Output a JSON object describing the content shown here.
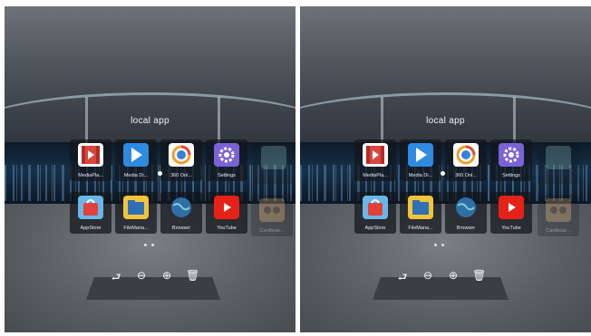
{
  "panel": {
    "title": "local app"
  },
  "apps": [
    {
      "label": "MediaPla...",
      "icon": "media-player-icon",
      "color": "#d9473f"
    },
    {
      "label": "Media Di...",
      "icon": "media-di-icon",
      "color": "#2e8be0"
    },
    {
      "label": "360 Onl...",
      "icon": "360-online-icon",
      "color": "#ffffff"
    },
    {
      "label": "Settings",
      "icon": "settings-icon",
      "color": "#7a63d6"
    },
    {
      "label": "",
      "icon": "faded-app-icon",
      "color": "#7ea1a0"
    },
    {
      "label": "AppStore",
      "icon": "app-store-icon",
      "color": "#e2403a"
    },
    {
      "label": "FileMana...",
      "icon": "file-manager-icon",
      "color": "#f3c43a"
    },
    {
      "label": "Browser",
      "icon": "browser-icon",
      "color": "#2f6fa7"
    },
    {
      "label": "YouTube",
      "icon": "youtube-icon",
      "color": "#e62117"
    },
    {
      "label": "Cardboar...",
      "icon": "cardboard-icon",
      "color": "#c79a5e"
    }
  ],
  "toolbar": {
    "back": "⮐",
    "prev": "⊖",
    "next": "⊕",
    "delete": "🗑"
  }
}
